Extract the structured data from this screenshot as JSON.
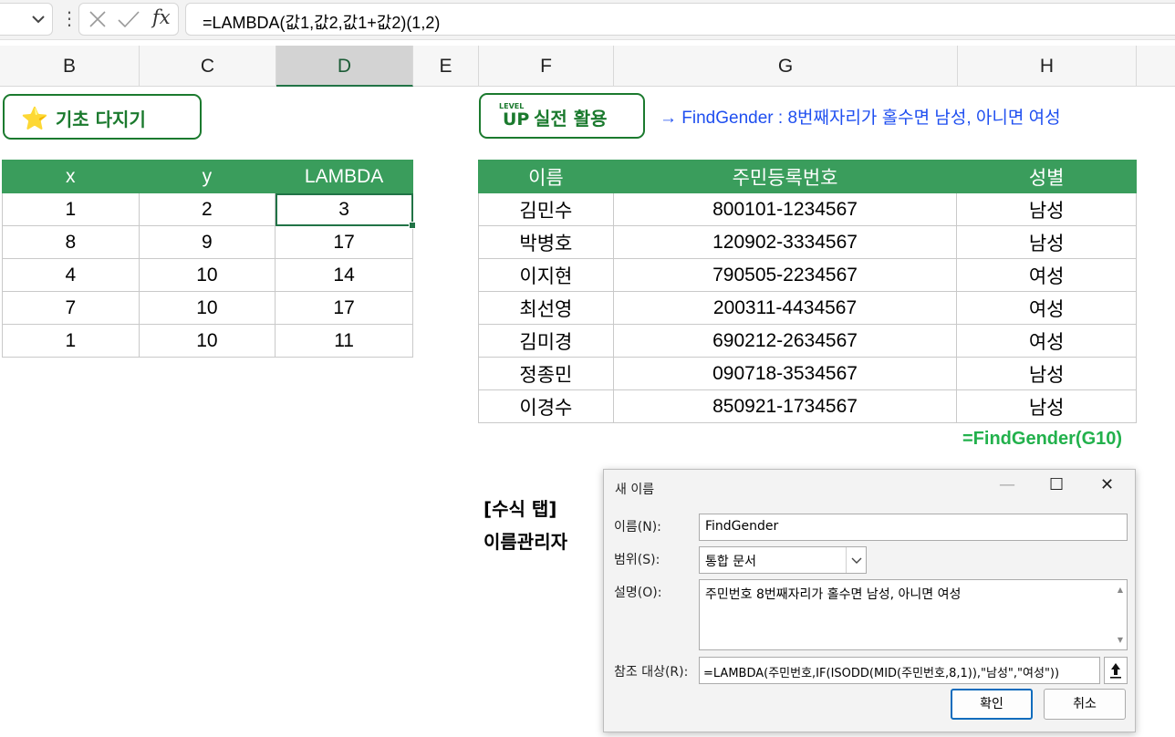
{
  "formula_bar": {
    "formula": "=LAMBDA(값1,값2,값1+값2)(1,2)",
    "name_box_chevron": "chevron-down-icon",
    "more_icon": "vertical-dots-icon",
    "cancel_icon": "cancel-x-icon",
    "enter_icon": "checkmark-icon",
    "fx_label": "fx"
  },
  "columns": [
    "B",
    "C",
    "D",
    "E",
    "F",
    "G",
    "H"
  ],
  "badges": {
    "basic": "기초 다지기",
    "basic_icon": "⭐",
    "advanced_level": "LEVEL",
    "advanced_up": "UP",
    "advanced": "실전 활용"
  },
  "find_gender_note": "→ FindGender : 8번째자리가 홀수면 남성, 아니면 여성",
  "lambda_table": {
    "headers": [
      "x",
      "y",
      "LAMBDA"
    ],
    "rows": [
      [
        "1",
        "2",
        "3"
      ],
      [
        "8",
        "9",
        "17"
      ],
      [
        "4",
        "10",
        "14"
      ],
      [
        "7",
        "10",
        "17"
      ],
      [
        "1",
        "10",
        "11"
      ]
    ]
  },
  "gender_table": {
    "headers": [
      "이름",
      "주민등록번호",
      "성별"
    ],
    "rows": [
      [
        "김민수",
        "800101-1234567",
        "남성"
      ],
      [
        "박병호",
        "120902-3334567",
        "남성"
      ],
      [
        "이지현",
        "790505-2234567",
        "여성"
      ],
      [
        "최선영",
        "200311-4434567",
        "여성"
      ],
      [
        "김미경",
        "690212-2634567",
        "여성"
      ],
      [
        "정종민",
        "090718-3534567",
        "남성"
      ],
      [
        "이경수",
        "850921-1734567",
        "남성"
      ]
    ]
  },
  "gender_formula": "=FindGender(G10)",
  "tab_label": {
    "line1": "[수식 탭]",
    "line2": "이름관리자"
  },
  "dialog": {
    "title": "새 이름",
    "minimize": "—",
    "maximize": "☐",
    "close": "✕",
    "name_label": "이름(N):",
    "name_value": "FindGender",
    "scope_label": "범위(S):",
    "scope_value": "통합 문서",
    "comment_label": "설명(O):",
    "comment_value": "주민번호 8번째자리가 홀수면 남성, 아니면 여성",
    "ref_label": "참조 대상(R):",
    "ref_value": "=LAMBDA(주민번호,IF(ISODD(MID(주민번호,8,1)),\"남성\",\"여성\"))",
    "ok": "확인",
    "cancel": "취소"
  }
}
